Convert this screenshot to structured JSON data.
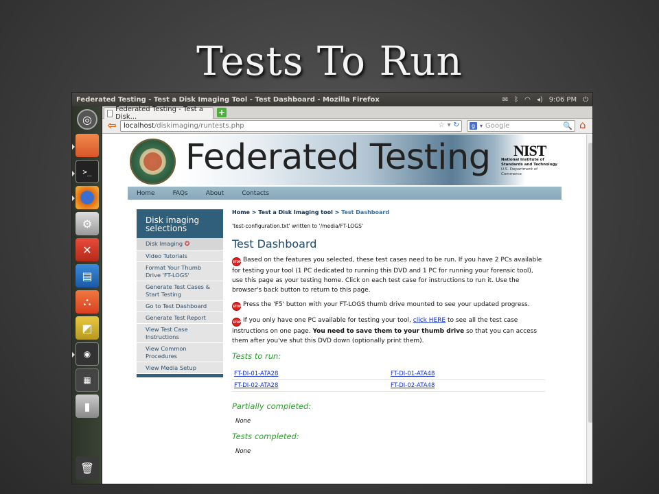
{
  "slide": {
    "title": "Tests To Run"
  },
  "topbar": {
    "window_title": "Federated Testing - Test a Disk Imaging Tool - Test Dashboard - Mozilla Firefox",
    "clock": "9:06 PM"
  },
  "tabs": [
    {
      "label": "Federated Testing - Test a Disk..."
    }
  ],
  "address": {
    "host": "localhost",
    "path": "/diskimaging/runtests.php"
  },
  "search": {
    "placeholder": "Google"
  },
  "banner": {
    "seal_top": "COMPUTER FORENSIC",
    "seal_bottom": "TOOL TESTING",
    "title": "Federated Testing",
    "nist_logo": "NIST",
    "nist_line1": "National Institute of",
    "nist_line2": "Standards and Technology",
    "nist_line3": "U.S. Department of Commerce"
  },
  "nav": [
    "Home",
    "FAQs",
    "About",
    "Contacts"
  ],
  "sidebar": {
    "heading": "Disk imaging selections",
    "items": [
      {
        "label": "Disk Imaging"
      },
      {
        "label": "Video Tutorials"
      },
      {
        "label": "Format Your Thumb Drive 'FT-LOGS'"
      },
      {
        "label": "Generate Test Cases & Start Testing"
      },
      {
        "label": "Go to Test Dashboard"
      },
      {
        "label": "Generate Test Report"
      },
      {
        "label": "View Test Case Instructions"
      },
      {
        "label": "View Common Procedures"
      },
      {
        "label": "View Media Setup"
      }
    ]
  },
  "breadcrumb": {
    "home": "Home",
    "sep1": " > ",
    "level2": "Test a Disk Imaging tool",
    "sep2": " > ",
    "current": "Test Dashboard"
  },
  "config_note": "'test-configuration.txt' written to '/media/FT-LOGS'",
  "dashboard": {
    "title": "Test Dashboard",
    "stop_icon_text": "STOP",
    "p1": "Based on the features you selected, these test cases need to be run. If you have 2 PCs available for testing your tool (1 PC dedicated to running this DVD and 1 PC for running your forensic tool), use this page as your testing home. Click on each test case for instructions to run it. Use the browser's back button to return to this page.",
    "p2": "Press the 'F5' button with your FT-LOGS thumb drive mounted to see your updated progress.",
    "p3_a": "If you only have one PC available for testing your tool, ",
    "p3_link": "click HERE",
    "p3_b": " to see all the test case instructions on one page. ",
    "p3_bold": "You need to save them to your thumb drive",
    "p3_c": " so that you can access them after you've shut this DVD down (optionally print them).",
    "tests_to_run_label": "Tests to run:",
    "tests": [
      [
        "FT-DI-01-ATA28",
        "FT-DI-01-ATA48"
      ],
      [
        "FT-DI-02-ATA28",
        "FT-DI-02-ATA48"
      ]
    ],
    "partial_label": "Partially completed:",
    "partial_value": "None",
    "completed_label": "Tests completed:",
    "completed_value": "None"
  }
}
